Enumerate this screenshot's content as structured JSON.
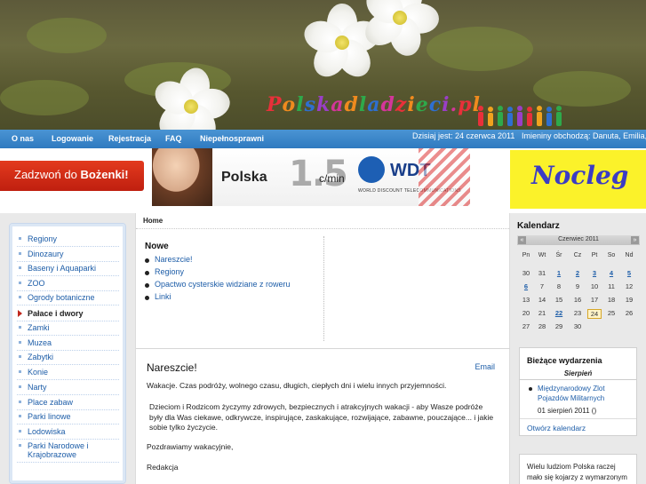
{
  "header": {
    "logo_text": "Polska dla dzieci.pl"
  },
  "nav": {
    "items": [
      "O nas",
      "Logowanie",
      "Rejestracja",
      "FAQ",
      "Niepełnosprawni"
    ],
    "date_info": "Dzisiaj jest: 24 czerwca 2011",
    "namedays": "Imieniny obchodzą: Danuta, Emilia, Jan"
  },
  "banners": {
    "call": {
      "prefix": "Zadzwoń do ",
      "name": "Bożenki!"
    },
    "wdt": {
      "country": "Polska",
      "price": "1.5",
      "unit": "c/min",
      "logo": "WDT",
      "tagline": "WORLD DISCOUNT TELECOMMUNICATIONS"
    },
    "nocleg": "Nocleg"
  },
  "left_menu": {
    "items": [
      "Regiony",
      "Dinozaury",
      "Baseny i Aquaparki",
      "ZOO",
      "Ogrody botaniczne",
      "Pałace i dwory",
      "Zamki",
      "Muzea",
      "Zabytki",
      "Konie",
      "Narty",
      "Place zabaw",
      "Parki linowe",
      "Lodowiska",
      "Parki Narodowe i Krajobrazowe"
    ],
    "active_index": 5
  },
  "main": {
    "breadcrumb": "Home",
    "news": {
      "title": "Nowe",
      "items": [
        "Nareszcie!",
        "Regiony",
        "Opactwo cysterskie widziane z roweru",
        "Linki"
      ]
    },
    "article": {
      "title": "Nareszcie!",
      "email_label": "Email",
      "paragraphs": [
        "Wakacje. Czas podróży, wolnego czasu, długich, ciepłych dni i wielu innych przyjemności.",
        "Dzieciom i Rodzicom życzymy zdrowych, bezpiecznych i atrakcyjnych wakacji - aby Wasze podróże były dla Was ciekawe, odkrywcze, inspirujące, zaskakujące, rozwijające, zabawne, pouczające... i jakie sobie tylko życzycie.",
        "Pozdrawiamy wakacyjnie,",
        "Redakcja"
      ]
    }
  },
  "calendar": {
    "title": "Kalendarz",
    "month_label": "Czerwiec 2011",
    "prev_label": "«",
    "next_label": "»",
    "weekdays": [
      "Pn",
      "Wt",
      "Śr",
      "Cz",
      "Pt",
      "So",
      "Nd"
    ],
    "weeks": [
      [
        "30",
        "31",
        "1",
        "2",
        "3",
        "4",
        "5"
      ],
      [
        "6",
        "7",
        "8",
        "9",
        "10",
        "11",
        "12"
      ],
      [
        "13",
        "14",
        "15",
        "16",
        "17",
        "18",
        "19"
      ],
      [
        "20",
        "21",
        "22",
        "23",
        "24",
        "25",
        "26"
      ],
      [
        "27",
        "28",
        "29",
        "30",
        "",
        "",
        ""
      ]
    ],
    "linked_days": [
      "1",
      "2",
      "3",
      "4",
      "5",
      "6",
      "22"
    ],
    "today": "24"
  },
  "events": {
    "title": "Bieżące wydarzenia",
    "month": "Sierpień",
    "items": [
      {
        "label": "Międzynarodowy Zlot Pojazdów Militarnych",
        "date": "01 sierpień 2011 ()"
      }
    ],
    "footer": "Otwórz kalendarz"
  },
  "quote": {
    "text": "Wielu ludziom Polska raczej mało się kojarzy z wymarzonym"
  },
  "colors": {
    "nav_blue": "#2f7ac0",
    "link_blue": "#1d5da8",
    "call_red": "#c0281d",
    "nocleg_yellow": "#fbf22a"
  }
}
